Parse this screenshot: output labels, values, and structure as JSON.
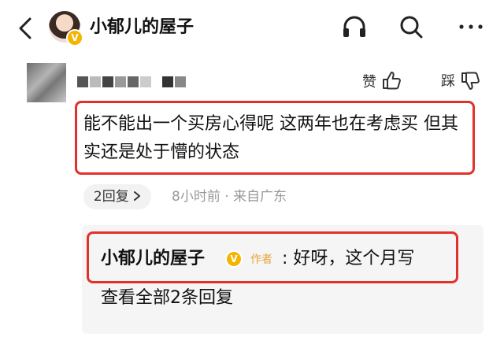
{
  "header": {
    "title": "小郁儿的屋子",
    "avatar_badge": "V"
  },
  "comment": {
    "like_label": "赞",
    "dislike_label": "踩",
    "text": "能不能出一个买房心得呢 这两年也在考虑买 但其实还是处于懵的状态",
    "reply_count_label": "2回复",
    "meta": "8小时前 · 来自广东"
  },
  "reply": {
    "author": "小郁儿的屋子",
    "badge": "V",
    "author_tag": "作者",
    "text": ": 好呀，这个月写",
    "view_all_label": "查看全部2条回复"
  },
  "colors": {
    "highlight_box": "#e2312b",
    "verified_badge": "#f5b400",
    "author_tag": "#e8a33a"
  }
}
